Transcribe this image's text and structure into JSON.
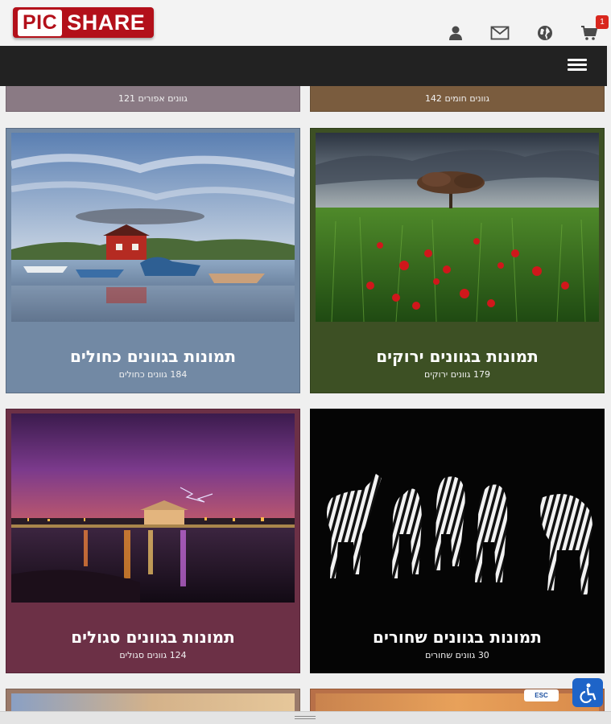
{
  "header": {
    "logo_pic": "PIC",
    "logo_share": "SHARE",
    "cart_count": "1",
    "icons": [
      "user-icon",
      "mail-icon",
      "globe-icon",
      "cart-icon"
    ]
  },
  "nav": {
    "menu_icon": "hamburger-icon"
  },
  "top_strips": [
    {
      "label": "142 גוונים חומים",
      "color": "#7a5c3e"
    },
    {
      "label": "121 גוונים אפורים",
      "color": "#8a7a84"
    }
  ],
  "cards": [
    {
      "title": "תמונות בגוונים ירוקים",
      "count": "179 גוונים ירוקים",
      "color": "#3d5024",
      "photo": "tree-poppy-field"
    },
    {
      "title": "תמונות בגוונים כחולים",
      "count": "184 גוונים כחולים",
      "color": "#7289a4",
      "photo": "harbor-boats-red-house"
    },
    {
      "title": "תמונות בגוונים שחורים",
      "count": "30 גוונים שחורים",
      "color": "#050505",
      "photo": "zebras-on-black"
    },
    {
      "title": "תמונות בגוונים סגולים",
      "count": "124 גוונים סגולים",
      "color": "#6c3046",
      "photo": "night-lightning-pier"
    }
  ],
  "footer": {
    "esc_label": "ESC",
    "accessibility_icon": "wheelchair-icon"
  }
}
